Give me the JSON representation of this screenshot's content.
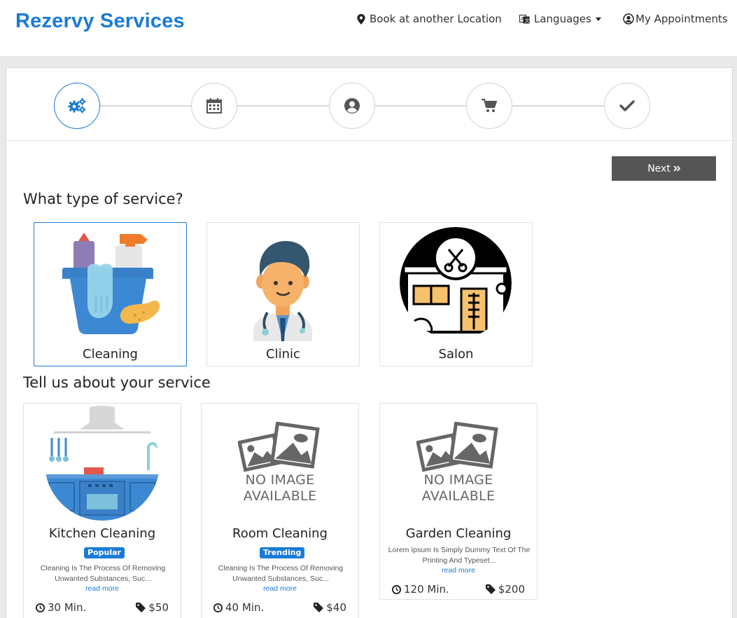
{
  "header": {
    "brand": "Rezervy Services",
    "nav": {
      "location": "Book at another Location",
      "languages": "Languages",
      "appointments": "My Appointments"
    }
  },
  "accent_color": "#1a7bd7",
  "steps": [
    {
      "icon": "gears-icon",
      "active": true
    },
    {
      "icon": "calendar-icon",
      "active": false
    },
    {
      "icon": "user-circle-icon",
      "active": false
    },
    {
      "icon": "cart-icon",
      "active": false
    },
    {
      "icon": "check-icon",
      "active": false
    }
  ],
  "next_label": "Next",
  "service_type": {
    "title": "What type of service?",
    "options": [
      {
        "label": "Cleaning",
        "selected": true
      },
      {
        "label": "Clinic",
        "selected": false
      },
      {
        "label": "Salon",
        "selected": false
      }
    ]
  },
  "services": {
    "title": "Tell us about your service",
    "items": [
      {
        "name": "Kitchen Cleaning",
        "badge": "Popular",
        "description_line1": "Cleaning Is The Process Of Removing",
        "description_line2": "Unwanted Substances, Suc...",
        "read_more": "read more",
        "duration": "30 Min.",
        "price": "$50"
      },
      {
        "name": "Room Cleaning",
        "badge": "Trending",
        "image_text_line1": "NO IMAGE",
        "image_text_line2": "AVAILABLE",
        "description_line1": "Cleaning Is The Process Of Removing",
        "description_line2": "Unwanted Substances, Suc...",
        "read_more": "read more",
        "duration": "40 Min.",
        "price": "$40"
      },
      {
        "name": "Garden Cleaning",
        "image_text_line1": "NO IMAGE",
        "image_text_line2": "AVAILABLE",
        "description_line1": "Lorem Ipsum Is Simply Dummy Text Of The",
        "description_line2": "Printing And Typeset...",
        "read_more": "read more",
        "duration": "120 Min.",
        "price": "$200"
      }
    ]
  }
}
